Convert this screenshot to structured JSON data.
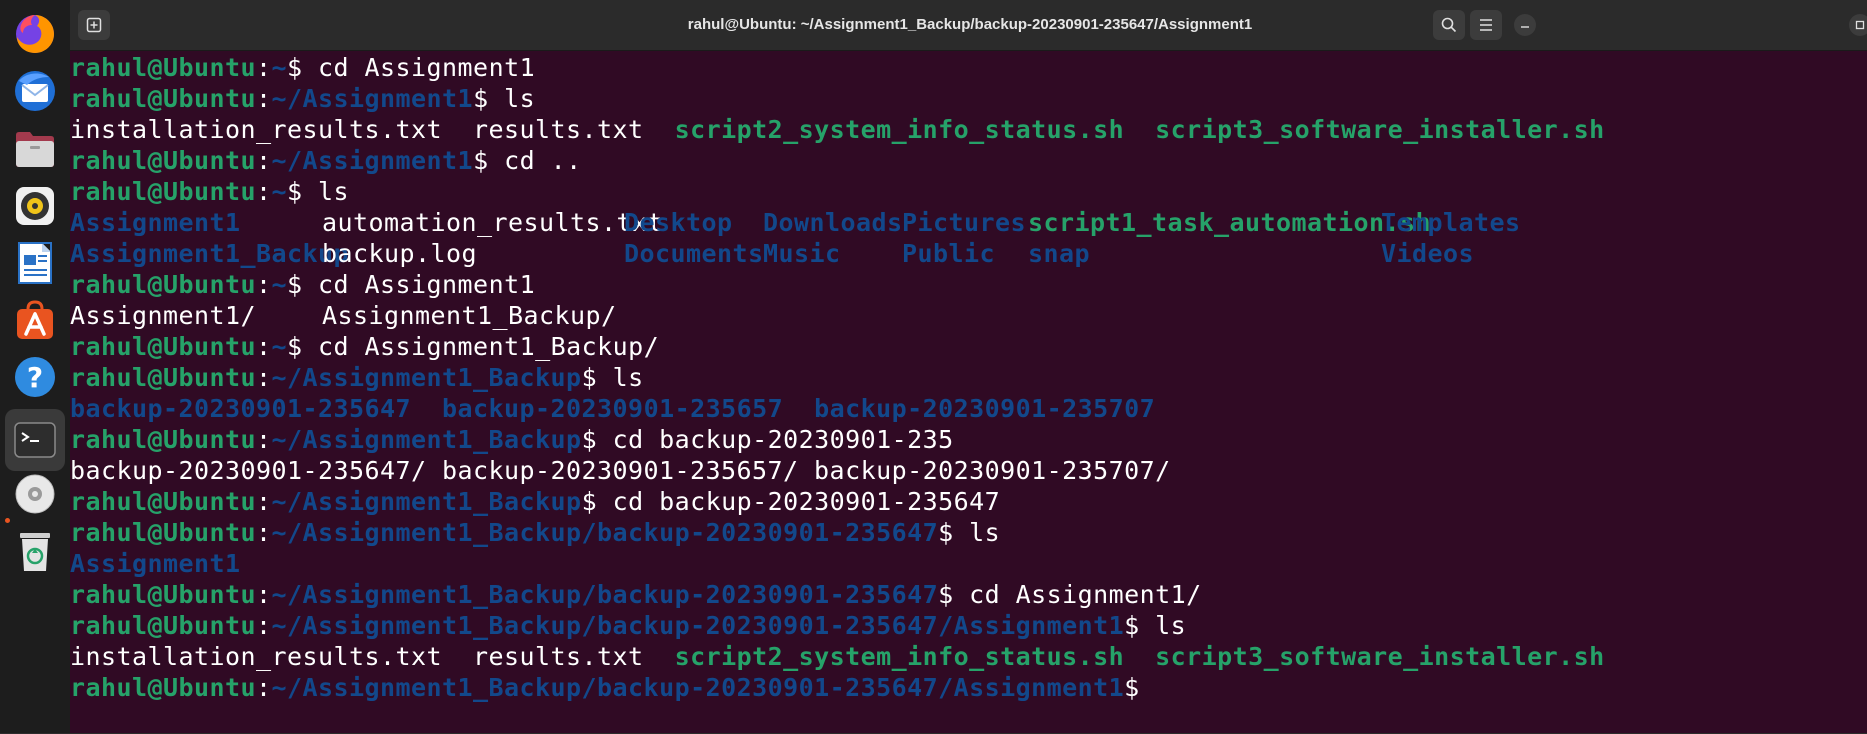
{
  "window": {
    "title": "rahul@Ubuntu: ~/Assignment1_Backup/backup-20230901-235647/Assignment1"
  },
  "dock": {
    "items": [
      {
        "name": "firefox-icon"
      },
      {
        "name": "thunderbird-icon"
      },
      {
        "name": "files-icon"
      },
      {
        "name": "rhythmbox-icon"
      },
      {
        "name": "libreoffice-writer-icon"
      },
      {
        "name": "software-center-icon"
      },
      {
        "name": "help-icon"
      },
      {
        "name": "terminal-icon"
      },
      {
        "name": "disc-icon"
      },
      {
        "name": "trash-icon"
      }
    ]
  },
  "terminal": {
    "user": "rahul@Ubuntu",
    "sep": ":",
    "lines": {
      "l1": {
        "path": "~",
        "cmd": "$ cd Assignment1"
      },
      "l2": {
        "path": "~/Assignment1",
        "cmd": "$ ls"
      },
      "l3": {
        "f1": "installation_results.txt",
        "f2": "results.txt",
        "f3": "script2_system_info_status.sh",
        "f4": "script3_software_installer.sh"
      },
      "l4": {
        "path": "~/Assignment1",
        "cmd": "$ cd .."
      },
      "l5": {
        "path": "~",
        "cmd": "$ ls"
      },
      "l6": {
        "c1": "Assignment1",
        "c2": "automation_results.txt",
        "c3": "Desktop",
        "c4": "Downloads",
        "c5": "Pictures",
        "c6": "script1_task_automation.sh",
        "c7": "Templates"
      },
      "l7": {
        "c1": "Assignment1_Backup",
        "c2": "backup.log",
        "c3": "Documents",
        "c4": "Music",
        "c5": "Public",
        "c6": "snap",
        "c7": "Videos"
      },
      "l8": {
        "path": "~",
        "cmd": "$ cd Assignment1"
      },
      "l9": {
        "c1": "Assignment1/",
        "c2": "Assignment1_Backup/"
      },
      "l10": {
        "path": "~",
        "cmd": "$ cd Assignment1_Backup/"
      },
      "l11": {
        "path": "~/Assignment1_Backup",
        "cmd": "$ ls"
      },
      "l12": {
        "b1": "backup-20230901-235647",
        "b2": "backup-20230901-235657",
        "b3": "backup-20230901-235707"
      },
      "l13": {
        "path": "~/Assignment1_Backup",
        "cmd": "$ cd backup-20230901-235"
      },
      "l14": {
        "text": "backup-20230901-235647/ backup-20230901-235657/ backup-20230901-235707/"
      },
      "l15": {
        "path": "~/Assignment1_Backup",
        "cmd": "$ cd backup-20230901-235647"
      },
      "l16": {
        "path": "~/Assignment1_Backup/backup-20230901-235647",
        "cmd": "$ ls"
      },
      "l17": {
        "d1": "Assignment1"
      },
      "l18": {
        "path": "~/Assignment1_Backup/backup-20230901-235647",
        "cmd": "$ cd Assignment1/"
      },
      "l19": {
        "path": "~/Assignment1_Backup/backup-20230901-235647/Assignment1",
        "cmd": "$ ls"
      },
      "l20": {
        "f1": "installation_results.txt",
        "f2": "results.txt",
        "f3": "script2_system_info_status.sh",
        "f4": "script3_software_installer.sh"
      },
      "l21": {
        "path": "~/Assignment1_Backup/backup-20230901-235647/Assignment1",
        "cmd": "$"
      }
    }
  },
  "colors": {
    "background": "#300a24",
    "user": "#26a269",
    "path": "#12488b",
    "text": "#ffffff"
  }
}
